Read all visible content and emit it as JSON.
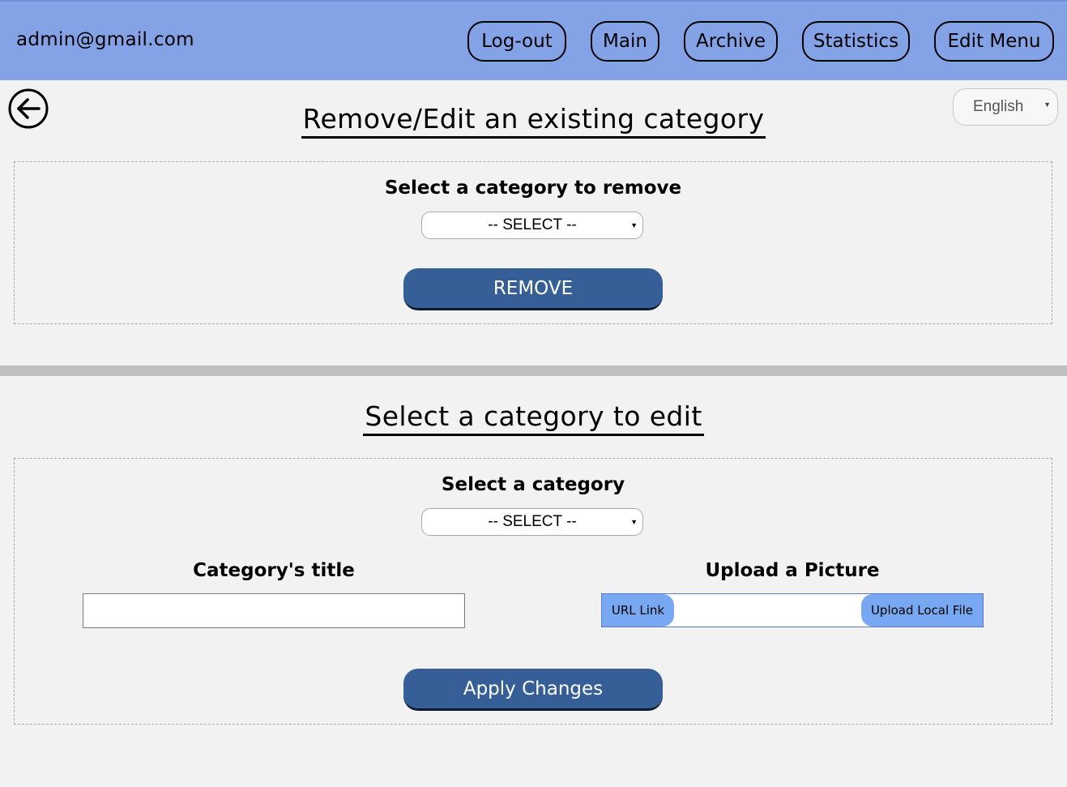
{
  "header": {
    "user_email": "admin@gmail.com",
    "nav": {
      "logout": "Log-out",
      "main": "Main",
      "archive": "Archive",
      "statistics": "Statistics",
      "edit_menu": "Edit Menu"
    },
    "background_color": "#84a3e6"
  },
  "language": {
    "selected": "English"
  },
  "remove_section": {
    "title": "Remove/Edit an existing category",
    "select_label": "Select a category to remove",
    "select_value": "-- SELECT --",
    "button_label": "REMOVE"
  },
  "edit_section": {
    "title": "Select a category to edit",
    "select_label": "Select a category",
    "select_value": "-- SELECT --",
    "title_field_label": "Category's title",
    "title_field_value": "",
    "upload_label": "Upload a Picture",
    "url_link_label": "URL Link",
    "upload_local_label": "Upload Local File",
    "apply_label": "Apply Changes"
  },
  "colors": {
    "accent_button": "#365f97",
    "upload_button": "#78a8f2"
  }
}
